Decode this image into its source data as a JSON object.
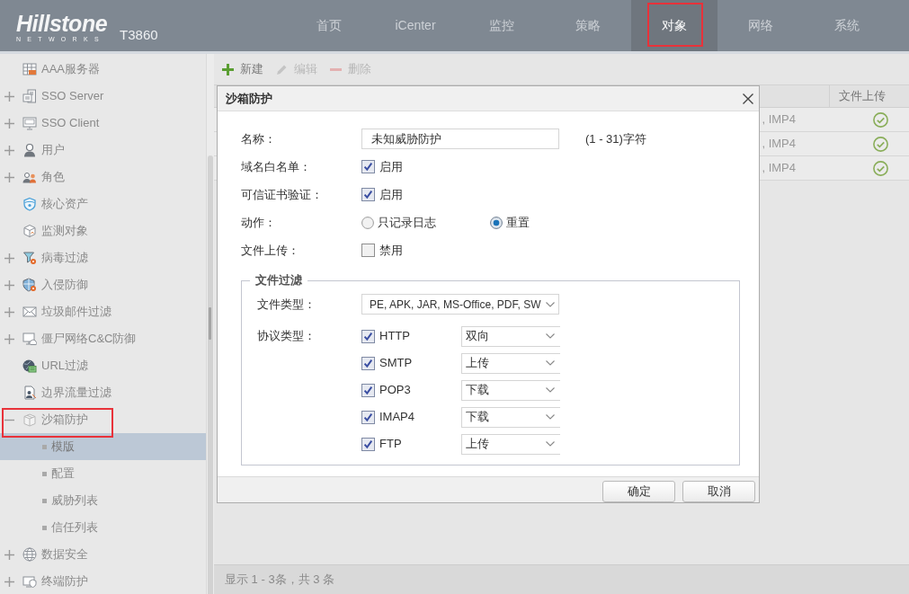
{
  "header": {
    "logo": {
      "name": "Hillstone",
      "tagline": "NETWORKS"
    },
    "model": "T3860",
    "nav": [
      {
        "label": "首页",
        "selected": false
      },
      {
        "label": "iCenter",
        "selected": false
      },
      {
        "label": "监控",
        "selected": false
      },
      {
        "label": "策略",
        "selected": false
      },
      {
        "label": "对象",
        "selected": true,
        "outlined": true
      },
      {
        "label": "网络",
        "selected": false
      },
      {
        "label": "系统",
        "selected": false
      }
    ]
  },
  "sidebar": {
    "items": [
      {
        "label": "AAA服务器",
        "selected": false
      },
      {
        "label": "SSO Server",
        "expanded": false,
        "selected": false
      },
      {
        "label": "SSO Client",
        "expanded": false,
        "selected": false
      },
      {
        "label": "用户",
        "expanded": false,
        "selected": false
      },
      {
        "label": "角色",
        "expanded": false,
        "selected": false
      },
      {
        "label": "核心资产",
        "selected": false
      },
      {
        "label": "监测对象",
        "selected": false
      },
      {
        "label": "病毒过滤",
        "expanded": false,
        "selected": false
      },
      {
        "label": "入侵防御",
        "expanded": false,
        "selected": false
      },
      {
        "label": "垃圾邮件过滤",
        "expanded": false,
        "selected": false
      },
      {
        "label": "僵尸网络C&C防御",
        "expanded": false,
        "selected": false
      },
      {
        "label": "URL过滤",
        "selected": false
      },
      {
        "label": "边界流量过滤",
        "selected": false
      },
      {
        "label": "沙箱防护",
        "expanded": true,
        "selected": false,
        "outlined": true,
        "children": [
          {
            "label": "模版",
            "selected": true
          },
          {
            "label": "配置",
            "selected": false
          },
          {
            "label": "威胁列表",
            "selected": false
          },
          {
            "label": "信任列表",
            "selected": false
          }
        ]
      },
      {
        "label": "数据安全",
        "expanded": false,
        "selected": false
      },
      {
        "label": "终端防护",
        "expanded": false,
        "selected": false
      }
    ]
  },
  "toolbar": {
    "buttons": [
      {
        "label": "新建",
        "disabled": false
      },
      {
        "label": "编辑",
        "disabled": true
      },
      {
        "label": "删除",
        "disabled": true
      }
    ]
  },
  "table": {
    "columns": [
      {
        "label": "文件上传"
      }
    ],
    "rows": [
      {
        "column_partial": ", IMP4",
        "file_upload": true
      },
      {
        "column_partial": ", IMP4",
        "file_upload": true
      },
      {
        "column_partial": ", IMP4",
        "file_upload": true
      }
    ]
  },
  "dialog": {
    "title": "沙箱防护",
    "fields": [
      {
        "kind": "text",
        "label": "名称：",
        "value": "未知威胁防护",
        "hint": "(1 - 31)字符"
      },
      {
        "kind": "checkbox",
        "label": "域名白名单：",
        "option": "启用",
        "checked": true
      },
      {
        "kind": "checkbox",
        "label": "可信证书验证：",
        "option": "启用",
        "checked": true
      },
      {
        "kind": "radio",
        "label": "动作：",
        "options": [
          {
            "label": "只记录日志",
            "selected": false
          },
          {
            "label": "重置",
            "selected": true
          }
        ]
      },
      {
        "kind": "checkbox",
        "label": "文件上传：",
        "option": "禁用",
        "checked": false
      }
    ],
    "file_filter": {
      "legend": "文件过滤",
      "file_type": {
        "label": "文件类型：",
        "value": "PE, APK, JAR, MS-Office, PDF, SW"
      },
      "protocol_label": "协议类型：",
      "protocols": [
        {
          "name": "HTTP",
          "checked": true,
          "direction": "双向"
        },
        {
          "name": "SMTP",
          "checked": true,
          "direction": "上传"
        },
        {
          "name": "POP3",
          "checked": true,
          "direction": "下载"
        },
        {
          "name": "IMAP4",
          "checked": true,
          "direction": "下载"
        },
        {
          "name": "FTP",
          "checked": true,
          "direction": "上传"
        }
      ]
    },
    "buttons": [
      "确定",
      "取消"
    ]
  },
  "status_bar": {
    "text": "显示 1 - 3条，共 3 条"
  }
}
